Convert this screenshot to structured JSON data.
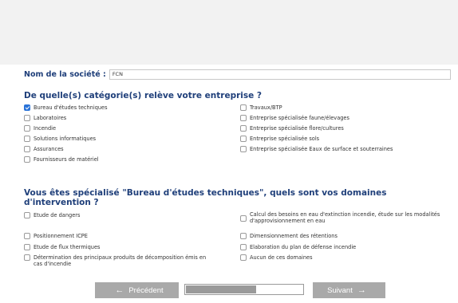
{
  "company": {
    "label": "Nom de la société :",
    "value": "FCN"
  },
  "q1": {
    "title": "De quelle(s) catégorie(s) relève votre entreprise ?",
    "options": [
      {
        "label": "Bureau d'études techniques",
        "checked": true
      },
      {
        "label": "Laboratoires",
        "checked": false
      },
      {
        "label": "Incendie",
        "checked": false
      },
      {
        "label": "Solutions informatiques",
        "checked": false
      },
      {
        "label": "Assurances",
        "checked": false
      },
      {
        "label": "Fournisseurs de matériel",
        "checked": false
      },
      {
        "label": "Travaux/BTP",
        "checked": false
      },
      {
        "label": "Entreprise spécialisée faune/élevages",
        "checked": false
      },
      {
        "label": "Entreprise spécialisée flore/cultures",
        "checked": false
      },
      {
        "label": "Entreprise spécialisée sols",
        "checked": false
      },
      {
        "label": "Entreprise spécialisée Eaux de surface et souterraines",
        "checked": false
      }
    ]
  },
  "q2": {
    "title": "Vous êtes spécialisé \"Bureau d'études techniques\", quels sont vos domaines d'intervention ?",
    "options": [
      {
        "label": "Etude de dangers",
        "checked": false
      },
      {
        "label": "Positionnement ICPE",
        "checked": false
      },
      {
        "label": "Etude de flux thermiques",
        "checked": false
      },
      {
        "label": "Détermination des principaux produits de décomposition émis en cas d'incendie",
        "checked": false
      },
      {
        "label": "Calcul des besoins en eau d'extinction incendie, étude sur les modalités d'approvisionnement en eau",
        "checked": false
      },
      {
        "label": "Dimensionnement des rétentions",
        "checked": false
      },
      {
        "label": "Elaboration du plan de défense incendie",
        "checked": false
      },
      {
        "label": "Aucun de ces domaines",
        "checked": false
      }
    ]
  },
  "nav": {
    "prev_label": "Précédent",
    "next_label": "Suivant",
    "progress_fraction": 0.6
  },
  "colors": {
    "heading": "#1f3f7a",
    "checkbox_checked": "#2a73d8",
    "button": "#a9a9a9"
  }
}
